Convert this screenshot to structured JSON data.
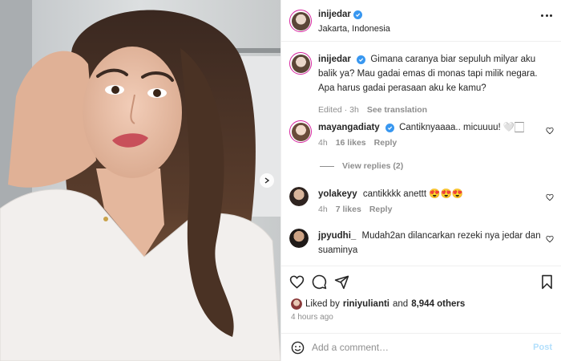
{
  "post": {
    "username": "inijedar",
    "location": "Jakarta, Indonesia",
    "caption": "Gimana caranya biar sepuluh milyar aku balik ya? Mau gadai emas di monas tapi milik negara. Apa harus gadai perasaan aku ke kamu?",
    "caption_edited": "Edited",
    "caption_time": "3h",
    "see_translation": "See translation"
  },
  "comments": [
    {
      "username": "mayangadiaty",
      "text": "Cantiknyaaaa.. micuuuu! 🤍🏻",
      "time": "4h",
      "likes": "16 likes",
      "reply": "Reply",
      "view_replies": "View replies (2)",
      "verified": true
    },
    {
      "username": "yolakeyy",
      "text": "cantikkkk anettt 😍😍😍",
      "time": "4h",
      "likes": "7 likes",
      "reply": "Reply",
      "verified": false
    },
    {
      "username": "jpyudhi_",
      "text": "Mudah2an dilancarkan rezeki nya jedar dan suaminya",
      "time": "",
      "likes": "",
      "reply": "",
      "verified": false
    }
  ],
  "likes": {
    "prefix": "Liked by",
    "user": "riniyulianti",
    "and": "and",
    "others": "8,944 others"
  },
  "timestamp": "4 hours ago",
  "add_comment": {
    "placeholder": "Add a comment…",
    "post_label": "Post"
  },
  "icons": [
    "more-icon",
    "verified-icon",
    "heart-icon",
    "comment-icon",
    "share-icon",
    "bookmark-icon",
    "emoji-icon",
    "carousel-next-icon"
  ],
  "colors": {
    "verified": "#3897f0",
    "post_disabled": "#b2dffc",
    "muted": "#8e8e8e",
    "text": "#262626",
    "story_ring": "#d6249f"
  }
}
